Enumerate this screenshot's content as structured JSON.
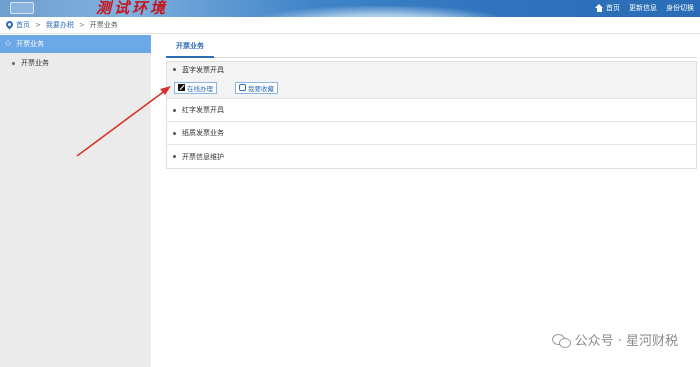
{
  "header": {
    "site_title": "测试环境",
    "links": {
      "home": "首页",
      "update": "更新信息",
      "switch_identity": "身份切换"
    }
  },
  "breadcrumb": {
    "items": [
      "首页",
      "我要办税",
      "开票业务"
    ],
    "separator": ">"
  },
  "sidebar": {
    "heading": "开票业务",
    "items": [
      {
        "label": "开票业务"
      }
    ]
  },
  "main": {
    "tab": "开票业务",
    "rows": [
      {
        "label": "蓝字发票开具"
      },
      {
        "label": "红字发票开具"
      },
      {
        "label": "纸质发票业务"
      },
      {
        "label": "开票信息维护"
      }
    ],
    "actions": {
      "online_handle": "在线办理",
      "favorite": "我要收藏"
    }
  },
  "watermark": {
    "text": "公众号 · 星河财税"
  },
  "colors": {
    "accent": "#2e6db4",
    "sidebar_head": "#6aa8e6",
    "title_red": "#c8151b",
    "arrow": "#d9322a"
  }
}
